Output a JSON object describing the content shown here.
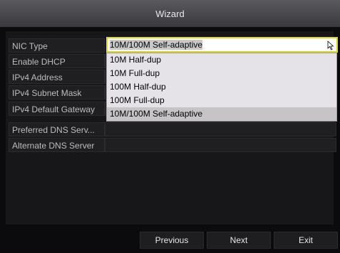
{
  "window": {
    "title": "Wizard"
  },
  "form": {
    "rows": [
      {
        "label": "NIC Type",
        "value": ""
      },
      {
        "label": "Enable DHCP",
        "value": ""
      },
      {
        "label": "IPv4 Address",
        "value": ""
      },
      {
        "label": "IPv4 Subnet Mask",
        "value": ""
      },
      {
        "label": "IPv4 Default Gateway",
        "value": ""
      },
      {
        "label": "Preferred DNS Serv...",
        "value": ""
      },
      {
        "label": "Alternate DNS Server",
        "value": ""
      }
    ],
    "nic_type": {
      "selected": "10M/100M Self-adaptive",
      "options": [
        "10M Half-dup",
        "10M Full-dup",
        "100M Half-dup",
        "100M Full-dup",
        "10M/100M Self-adaptive"
      ]
    }
  },
  "buttons": {
    "previous": "Previous",
    "next": "Next",
    "exit": "Exit"
  },
  "colors": {
    "focus_border": "#d8d43a",
    "dropdown_bg": "#e6e3e8",
    "dropdown_selected": "#c7c4c8",
    "title_bar": "#4a4a4e"
  },
  "icons": {
    "cursor": "mouse-pointer-icon"
  }
}
